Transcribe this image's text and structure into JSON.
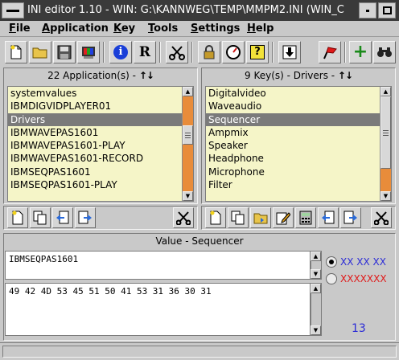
{
  "titlebar": {
    "title": "INI editor 1.10 - WIN: G:\\KANNWEG\\TEMP\\MMPM2.INI (WIN_C"
  },
  "menubar": {
    "items": [
      {
        "label": "File",
        "accel": "F",
        "rest": "ile"
      },
      {
        "label": "Application",
        "accel": "A",
        "rest": "pplication"
      },
      {
        "label": "Key",
        "accel": "K",
        "rest": "ey"
      },
      {
        "label": "Tools",
        "accel": "T",
        "rest": "ools"
      },
      {
        "label": "Settings",
        "accel": "S",
        "rest": "ettings"
      },
      {
        "label": "Help",
        "accel": "H",
        "rest": "elp"
      }
    ]
  },
  "toolbar": {
    "icons": [
      "new-file-icon",
      "open-folder-icon",
      "save-disk-icon",
      "print-icon",
      "info-icon",
      "registered-icon",
      "scissors-icon",
      "lock-icon",
      "gauge-icon",
      "help-question-icon",
      "download-arrow-icon",
      "flag-icon",
      "add-icon",
      "binoculars-icon"
    ],
    "glyphs": {
      "info": "i",
      "registered": "R",
      "question": "?",
      "add": "+"
    }
  },
  "applications": {
    "count": "22",
    "label": "Application(s)",
    "sort_glyph": "↑↓",
    "items": [
      "systemvalues",
      "IBMDIGVIDPLAYER01",
      "Drivers",
      "IBMWAVEPAS1601",
      "IBMWAVEPAS1601-PLAY",
      "IBMWAVEPAS1601-RECORD",
      "IBMSEQPAS1601",
      "IBMSEQPAS1601-PLAY"
    ],
    "selected_index": 2
  },
  "keys": {
    "count": "9",
    "label": "Key(s) - Drivers",
    "sort_glyph": "↑↓",
    "items": [
      "Digitalvideo",
      "Waveaudio",
      "Sequencer",
      "Ampmix",
      "Speaker",
      "Headphone",
      "Microphone",
      "Filter"
    ],
    "selected_index": 2
  },
  "value": {
    "header": "Value - Sequencer",
    "text": "IBMSEQPAS1601",
    "hex": "49 42 4D 53 45 51 50 41 53 31 36 30 31",
    "radio_hex_label": "XX XX XX",
    "radio_ascii_label": "XXXXXXX",
    "length": "13"
  },
  "colors": {
    "list_bg": "#f5f5c8",
    "selection": "#7a7a7a",
    "accent_blue": "#2b2bd6",
    "accent_red": "#e01818",
    "scroll_track": "#e88c3a"
  }
}
